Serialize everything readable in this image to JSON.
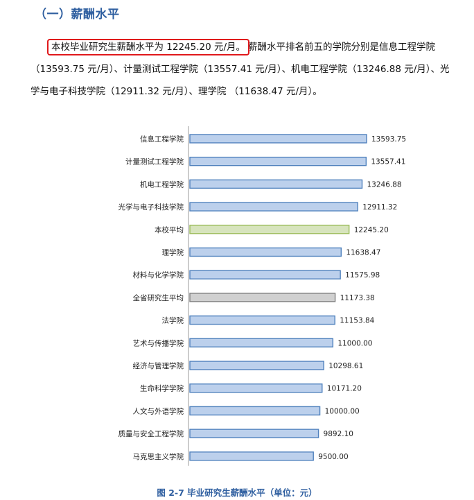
{
  "heading": "（一）薪酬水平",
  "paragraph": {
    "highlighted": "本校毕业研究生薪酬水平为 12245.20 元/月。",
    "rest": "薪酬水平排名前五的学院分别是信息工程学院（13593.75 元/月）、计量测试工程学院（13557.41 元/月）、机电工程学院（13246.88 元/月）、光学与电子科技学院（12911.32 元/月）、理学院 （11638.47 元/月）。"
  },
  "chart_data": {
    "type": "bar",
    "orientation": "horizontal",
    "categories": [
      "信息工程学院",
      "计量测试工程学院",
      "机电工程学院",
      "光学与电子科技学院",
      "本校平均",
      "理学院",
      "材料与化学学院",
      "全省研究生平均",
      "法学院",
      "艺术与传播学院",
      "经济与管理学院",
      "生命科学学院",
      "人文与外语学院",
      "质量与安全工程学院",
      "马克思主义学院"
    ],
    "values": [
      13593.75,
      13557.41,
      13246.88,
      12911.32,
      12245.2,
      11638.47,
      11575.98,
      11173.38,
      11153.84,
      11000.0,
      10298.61,
      10171.2,
      10000.0,
      9892.1,
      9500.0
    ],
    "value_labels": [
      "13593.75",
      "13557.41",
      "13246.88",
      "12911.32",
      "12245.20",
      "11638.47",
      "11575.98",
      "11173.38",
      "11153.84",
      "11000.00",
      "10298.61",
      "10171.20",
      "10000.00",
      "9892.10",
      "9500.00"
    ],
    "xlim": [
      0,
      15000
    ],
    "colors": {
      "default": "#bcd0ec",
      "default_edge": "#4f81bd",
      "school_avg": "#d7e4bd",
      "school_avg_edge": "#9bbb59",
      "province_avg": "#d0d0d0",
      "province_avg_edge": "#7f7f7f"
    },
    "special": {
      "本校平均": "school_avg",
      "全省研究生平均": "province_avg"
    },
    "title": "图 2-7 毕业研究生薪酬水平（单位：元）"
  }
}
